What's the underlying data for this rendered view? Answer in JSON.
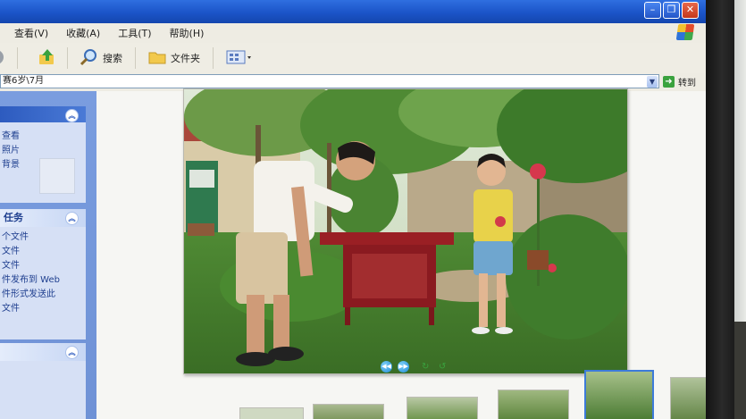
{
  "titlebar": {
    "min_btn": "–",
    "max_btn": "❐",
    "close_btn": "✕"
  },
  "menu": {
    "items": [
      "查看(V)",
      "收藏(A)",
      "工具(T)",
      "帮助(H)"
    ]
  },
  "toolbar": {
    "search_label": "搜索",
    "folders_label": "文件夹"
  },
  "address": {
    "value": "赛6岁\\7月",
    "go_label": "转到"
  },
  "taskpane": {
    "panel1": {
      "links": [
        "查看",
        "照片",
        "",
        "背景"
      ]
    },
    "panel2": {
      "title": "任务",
      "links": [
        "个文件",
        "文件",
        "文件",
        "件发布到 Web",
        "件形式发送此",
        "",
        "文件"
      ]
    }
  },
  "icons": {
    "back": "back-icon",
    "up": "folder-up-icon",
    "search": "search-icon",
    "folders": "folders-icon",
    "views": "views-icon",
    "go": "go-arrow-icon",
    "collapse": "chevron-up-icon",
    "prev": "previous-image-icon",
    "next": "next-image-icon",
    "rotate_cw": "rotate-clockwise-icon",
    "rotate_ccw": "rotate-counterclockwise-icon"
  },
  "colors": {
    "xp_blue": "#1b54c8",
    "task_blue": "#2d5bbf",
    "go_green": "#3aa23e"
  }
}
